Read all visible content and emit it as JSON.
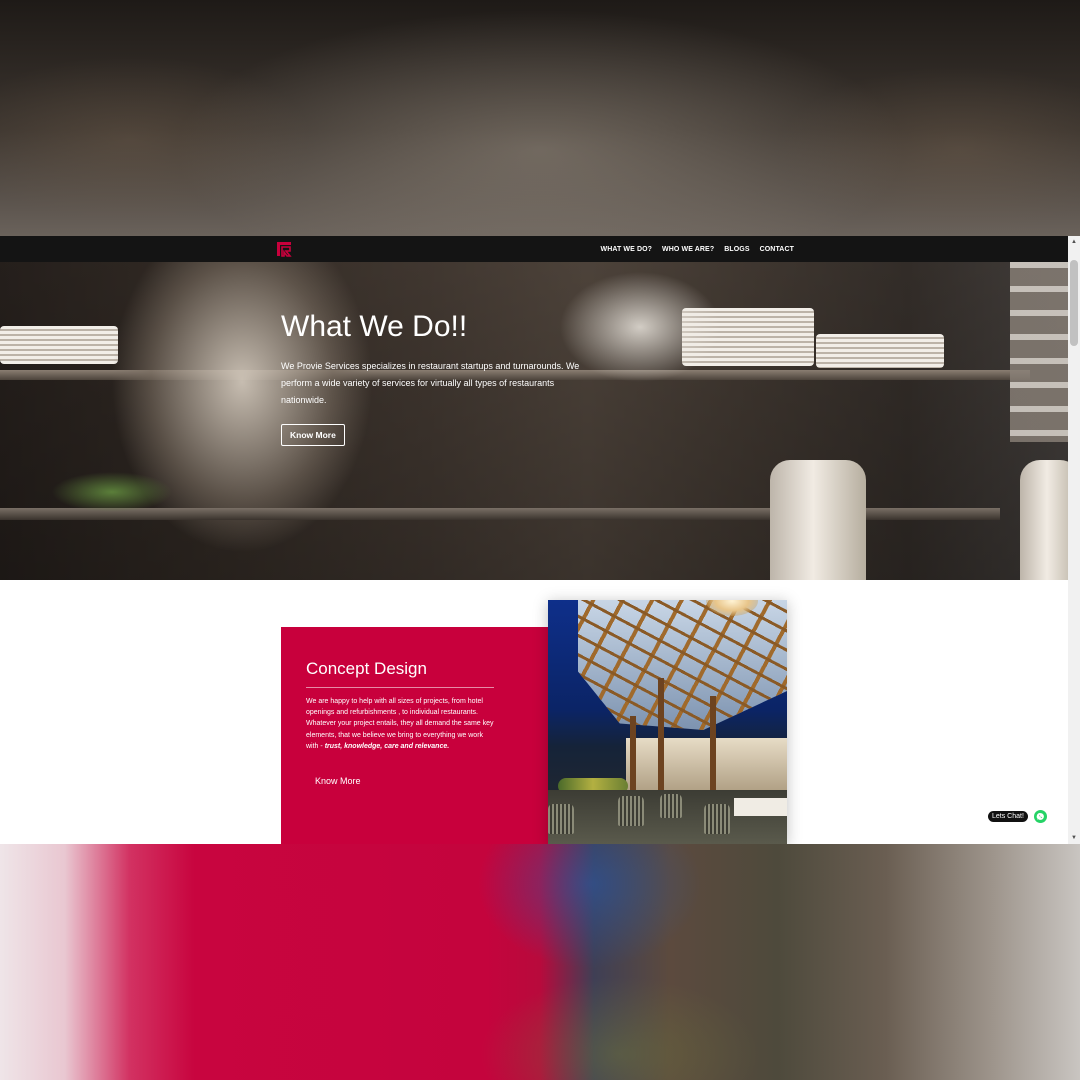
{
  "navbar": {
    "logo": "logo-mark",
    "items": [
      {
        "label": "WHAT WE DO?"
      },
      {
        "label": "WHO WE ARE?"
      },
      {
        "label": "BLOGS"
      },
      {
        "label": "CONTACT"
      }
    ]
  },
  "hero": {
    "title": "What We Do!!",
    "text": "We Provie Services specializes in restaurant startups and turnarounds. We perform a wide variety of services for virtually all types of restaurants nationwide.",
    "button": "Know More"
  },
  "concept": {
    "title": "Concept Design",
    "text": "We are happy to help with all sizes of projects, from hotel openings and refurbishments , to individual restaurants. Whatever your project entails, they all demand the same key elements, that we believe we bring to everything we work with -",
    "text_emphasis": "trust, knowledge, care and relevance.",
    "button": "Know More"
  },
  "chat": {
    "label": "Lets Chat!",
    "icon": "whatsapp-icon"
  },
  "scrollbar": {
    "up": "▲",
    "down": "▼"
  },
  "colors": {
    "brand": "#c8003c",
    "navbar": "#141414",
    "chat": "#25d366"
  }
}
